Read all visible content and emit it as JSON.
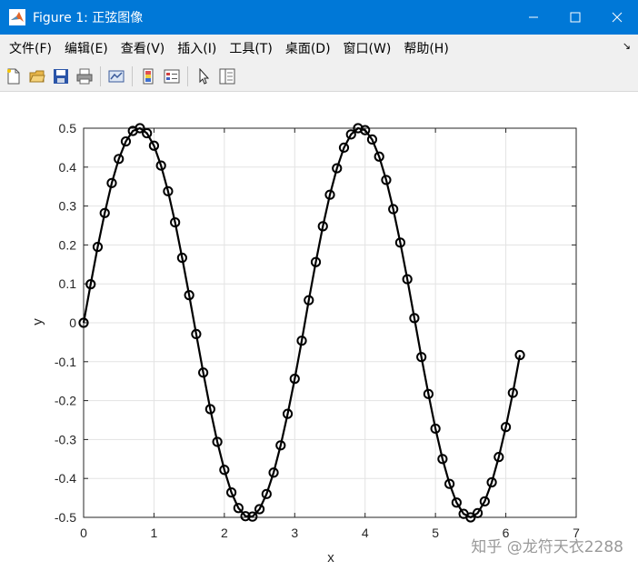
{
  "window": {
    "title": "Figure 1: 正弦图像",
    "controls": [
      "minimize",
      "maximize",
      "close"
    ]
  },
  "menu": [
    "文件(F)",
    "编辑(E)",
    "查看(V)",
    "插入(I)",
    "工具(T)",
    "桌面(D)",
    "窗口(W)",
    "帮助(H)"
  ],
  "toolbar": {
    "icons": [
      "new-figure-icon",
      "open-file-icon",
      "save-icon",
      "print-icon",
      "link-plot-icon",
      "colorbar-icon",
      "legend-icon",
      "pointer-icon",
      "property-editor-icon"
    ]
  },
  "watermark": "知乎 @龙符天衣2288",
  "chart_data": {
    "type": "line",
    "title": "",
    "xlabel": "x",
    "ylabel": "y",
    "xlim": [
      0,
      7
    ],
    "ylim": [
      -0.5,
      0.5
    ],
    "xticks": [
      "0",
      "1",
      "2",
      "3",
      "4",
      "5",
      "6",
      "7"
    ],
    "yticks": [
      "0.5",
      "0.4",
      "0.3",
      "0.2",
      "0.1",
      "0",
      "-0.1",
      "-0.2",
      "-0.3",
      "-0.4",
      "-0.5"
    ],
    "grid": true,
    "marker": "circle",
    "color": "#000000",
    "series": [
      {
        "x": [
          0,
          0.1,
          0.2,
          0.3,
          0.4,
          0.5,
          0.6,
          0.7,
          0.8,
          0.9,
          1.0,
          1.1,
          1.2,
          1.3,
          1.4,
          1.5,
          1.6,
          1.7,
          1.8,
          1.9,
          2.0,
          2.1,
          2.2,
          2.3,
          2.4,
          2.5,
          2.6,
          2.7,
          2.8,
          2.9,
          3.0,
          3.1,
          3.2,
          3.3,
          3.4,
          3.5,
          3.6,
          3.7,
          3.8,
          3.9,
          4.0,
          4.1,
          4.2,
          4.3,
          4.4,
          4.5,
          4.6,
          4.7,
          4.8,
          4.9,
          5.0,
          5.1,
          5.2,
          5.3,
          5.4,
          5.5,
          5.6,
          5.7,
          5.8,
          5.9,
          6.0,
          6.1,
          6.2
        ],
        "y": [
          0,
          0.099,
          0.195,
          0.282,
          0.359,
          0.421,
          0.466,
          0.493,
          0.5,
          0.487,
          0.455,
          0.404,
          0.338,
          0.258,
          0.167,
          0.071,
          -0.029,
          -0.128,
          -0.222,
          -0.306,
          -0.378,
          -0.436,
          -0.476,
          -0.497,
          -0.498,
          -0.479,
          -0.44,
          -0.385,
          -0.315,
          -0.234,
          -0.144,
          -0.046,
          0.058,
          0.156,
          0.248,
          0.329,
          0.397,
          0.45,
          0.484,
          0.5,
          0.495,
          0.471,
          0.427,
          0.367,
          0.292,
          0.206,
          0.112,
          0.012,
          -0.088,
          -0.183,
          -0.272,
          -0.35,
          -0.414,
          -0.462,
          -0.491,
          -0.5,
          -0.489,
          -0.459,
          -0.41,
          -0.345,
          -0.268,
          -0.18,
          -0.083
        ]
      }
    ]
  }
}
